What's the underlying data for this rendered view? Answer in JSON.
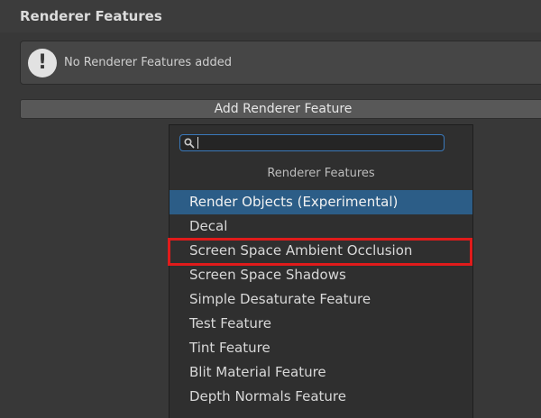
{
  "section": {
    "title": "Renderer Features"
  },
  "helpbox": {
    "icon": "warning-icon",
    "icon_glyph": "!",
    "message": "No Renderer Features added"
  },
  "add_button": {
    "label": "Add Renderer Feature"
  },
  "dropdown": {
    "search": {
      "icon": "search-icon",
      "value": "",
      "placeholder": ""
    },
    "header": "Renderer Features",
    "items": [
      {
        "label": "Render Objects (Experimental)",
        "selected": true
      },
      {
        "label": "Decal",
        "selected": false
      },
      {
        "label": "Screen Space Ambient Occlusion",
        "selected": false,
        "highlighted": true
      },
      {
        "label": "Screen Space Shadows",
        "selected": false
      },
      {
        "label": "Simple Desaturate Feature",
        "selected": false
      },
      {
        "label": "Test Feature",
        "selected": false
      },
      {
        "label": "Tint Feature",
        "selected": false
      },
      {
        "label": "Blit Material Feature",
        "selected": false
      },
      {
        "label": "Depth Normals Feature",
        "selected": false
      }
    ]
  },
  "colors": {
    "background": "#383838",
    "selected_item": "#2c5d87",
    "search_focus": "#3a79bb",
    "highlight_box": "#e01b1b"
  }
}
